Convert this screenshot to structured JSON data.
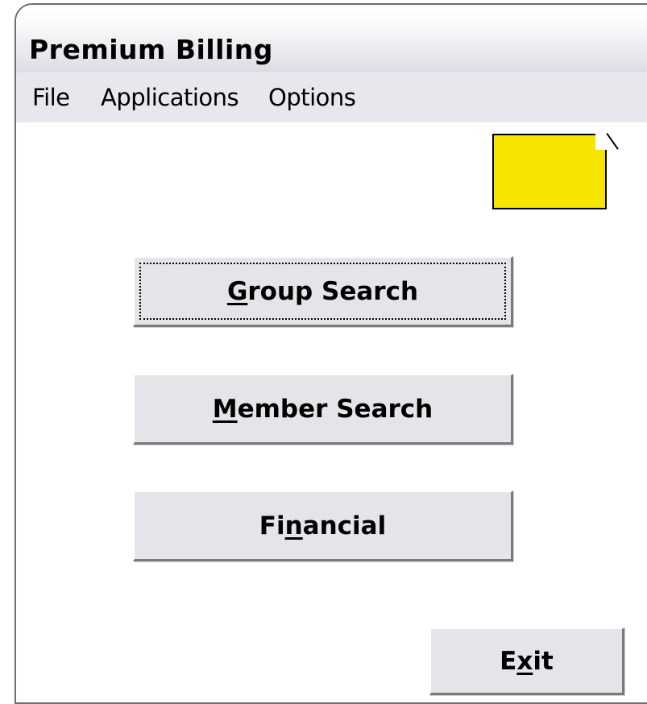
{
  "window": {
    "title": "Premium Billing"
  },
  "menu": {
    "file": "File",
    "applications": "Applications",
    "options": "Options"
  },
  "buttons": {
    "group_search": {
      "mnemonic": "G",
      "rest": "roup Search"
    },
    "member_search": {
      "mnemonic": "M",
      "rest": "ember Search"
    },
    "financial": {
      "before": "Fi",
      "mnemonic": "n",
      "after": "ancial"
    },
    "exit": {
      "before": "E",
      "mnemonic": "x",
      "after": "it"
    }
  },
  "colors": {
    "sticky_note": "#f5e500",
    "button_face": "#e5e5e9",
    "menubar": "#e7e7ee"
  }
}
